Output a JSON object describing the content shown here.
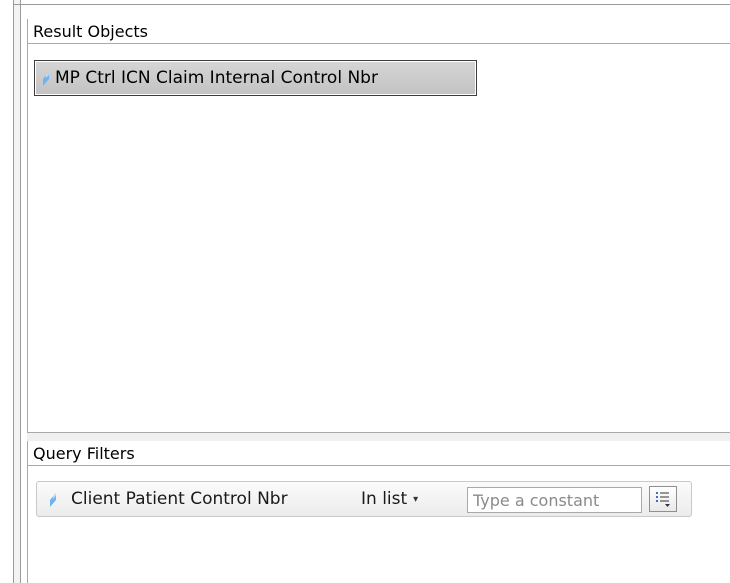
{
  "result_objects": {
    "header": "Result Objects",
    "items": [
      {
        "label": "MP Ctrl ICN Claim Internal Control Nbr",
        "icon": "dimension-object-icon",
        "selected": true
      }
    ]
  },
  "query_filters": {
    "header": "Query Filters",
    "filters": [
      {
        "object": "Client Patient Control Nbr",
        "icon": "dimension-object-icon",
        "operator": "In list",
        "constant_placeholder": "Type a constant",
        "constant_value": "",
        "value_picker_icon": "list-values-icon"
      }
    ]
  },
  "colors": {
    "object_icon": "#6fb4f0",
    "selected_chip_bg": "#c8c8c8",
    "border": "#a9a9a9"
  }
}
